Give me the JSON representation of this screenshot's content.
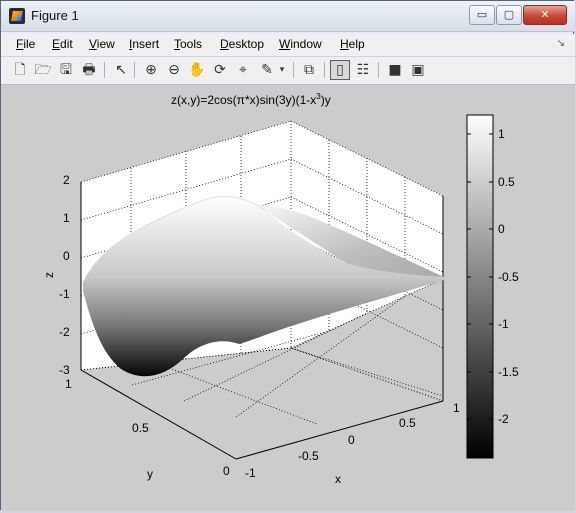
{
  "window": {
    "title": "Figure 1"
  },
  "window_controls": {
    "minimize": "▭",
    "maximize": "▢",
    "close": "✕"
  },
  "menu": [
    "File",
    "Edit",
    "View",
    "Insert",
    "Tools",
    "Desktop",
    "Window",
    "Help"
  ],
  "toolbar": [
    "new-figure-icon",
    "open-file-icon",
    "save-icon",
    "print-icon",
    "pointer-icon",
    "zoom-in-icon",
    "zoom-out-icon",
    "pan-icon",
    "rotate-3d-icon",
    "data-cursor-icon",
    "brush-icon",
    "brush-dropdown-icon",
    "link-plot-icon",
    "colorbar-icon",
    "legend-icon",
    "hide-plot-tools-icon",
    "show-plot-tools-icon"
  ],
  "plot": {
    "title_main": "z(x,y)=2cos(π*x)sin(3y)(1-x",
    "title_sup": "3",
    "title_tail": ")y",
    "zlabel": "z",
    "xlabel": "x",
    "ylabel": "y",
    "z_ticks": [
      "2",
      "1",
      "0",
      "-1",
      "-2",
      "-3"
    ],
    "x_ticks": [
      "-1",
      "-0.5",
      "0",
      "0.5",
      "1"
    ],
    "y_ticks": [
      "0",
      "0.5",
      "1"
    ],
    "colorbar_ticks": [
      "1",
      "0.5",
      "0",
      "-0.5",
      "-1",
      "-1.5",
      "-2"
    ],
    "colormap": "gray"
  }
}
